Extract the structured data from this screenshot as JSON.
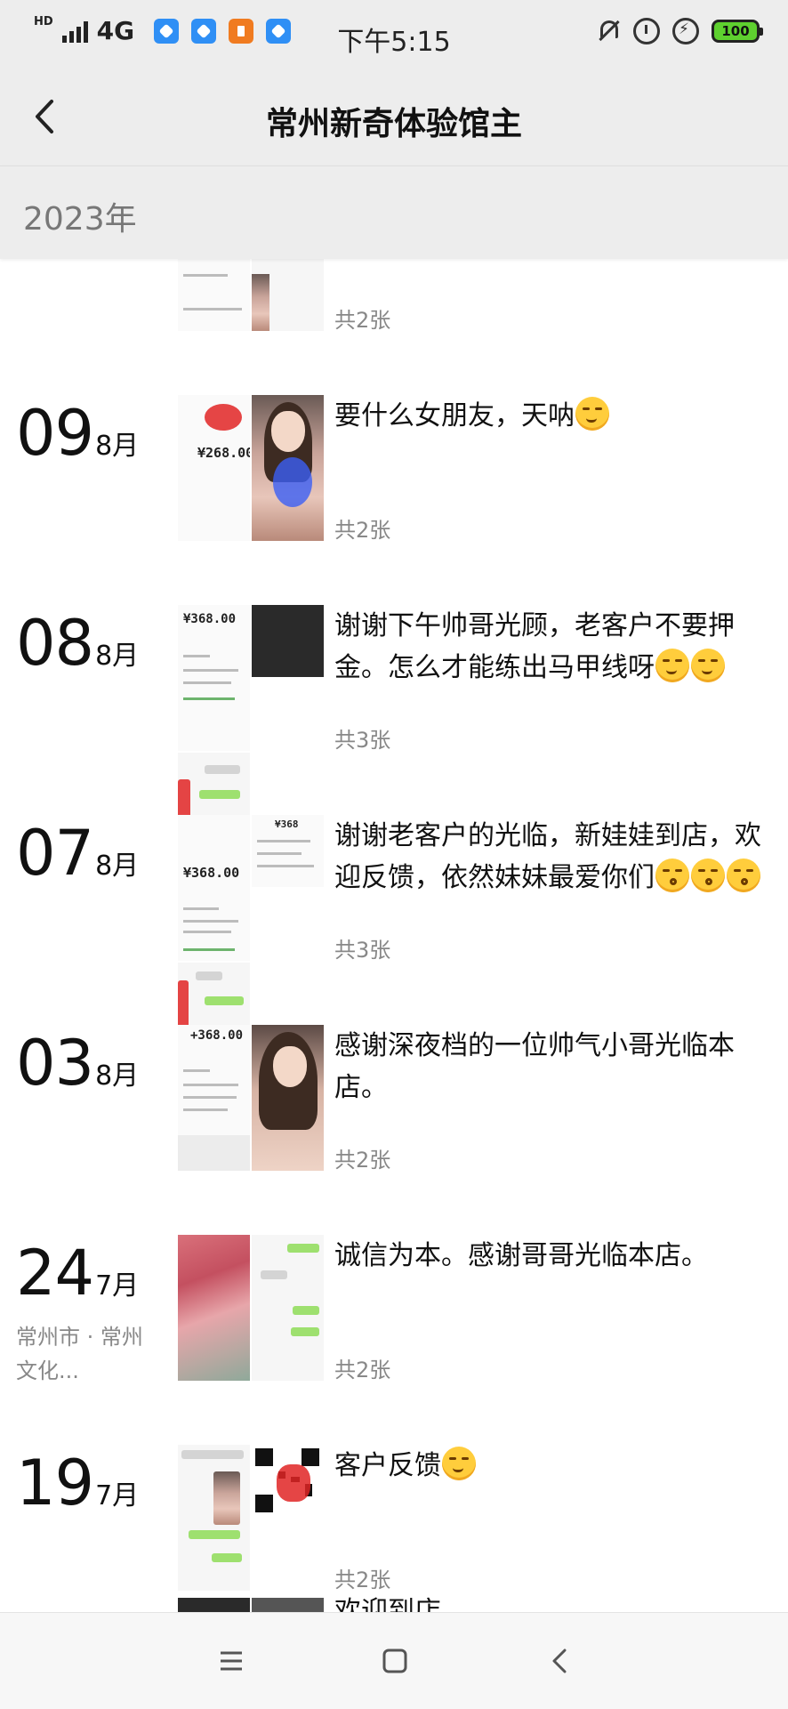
{
  "status_bar": {
    "hd": "HD",
    "network": "4G",
    "time": "下午5:15",
    "battery": "100"
  },
  "header": {
    "title": "常州新奇体验馆主"
  },
  "year_label": "2023年",
  "partial_top": {
    "count": "共2张"
  },
  "entries": [
    {
      "day": "09",
      "month": "8月",
      "text": "要什么女朋友，天呐",
      "count": "共2张"
    },
    {
      "day": "08",
      "month": "8月",
      "text": "谢谢下午帅哥光顾，老客户不要押金。怎么才能练出马甲线呀",
      "count": "共3张",
      "thumb_amount": "¥368.00"
    },
    {
      "day": "07",
      "month": "8月",
      "text": "谢谢老客户的光临，新娃娃到店，欢迎反馈，依然妹妹最爱你们",
      "count": "共3张",
      "thumb_amount": "¥368.00",
      "thumb_amount_small": "¥368"
    },
    {
      "day": "03",
      "month": "8月",
      "text": "感谢深夜档的一位帅气小哥光临本店。",
      "count": "共2张",
      "thumb_amount": "+368.00"
    },
    {
      "day": "24",
      "month": "7月",
      "location": "常州市 · 常州文化...",
      "text": "诚信为本。感谢哥哥光临本店。",
      "count": "共2张"
    },
    {
      "day": "19",
      "month": "7月",
      "text": "客户反馈",
      "count": "共2张"
    }
  ],
  "partial_bottom": {
    "text": "欢迎到店"
  },
  "thumb_amount_first": "¥268.00",
  "colors": {
    "bar_bg": "#ededed",
    "emoji": "#ffcd3c",
    "battery": "#5ed02f",
    "secondary_text": "#888888"
  },
  "icons": [
    "back-arrow-icon",
    "mute-icon",
    "alarm-icon",
    "charging-icon",
    "menu-icon",
    "home-icon",
    "back-nav-icon"
  ]
}
